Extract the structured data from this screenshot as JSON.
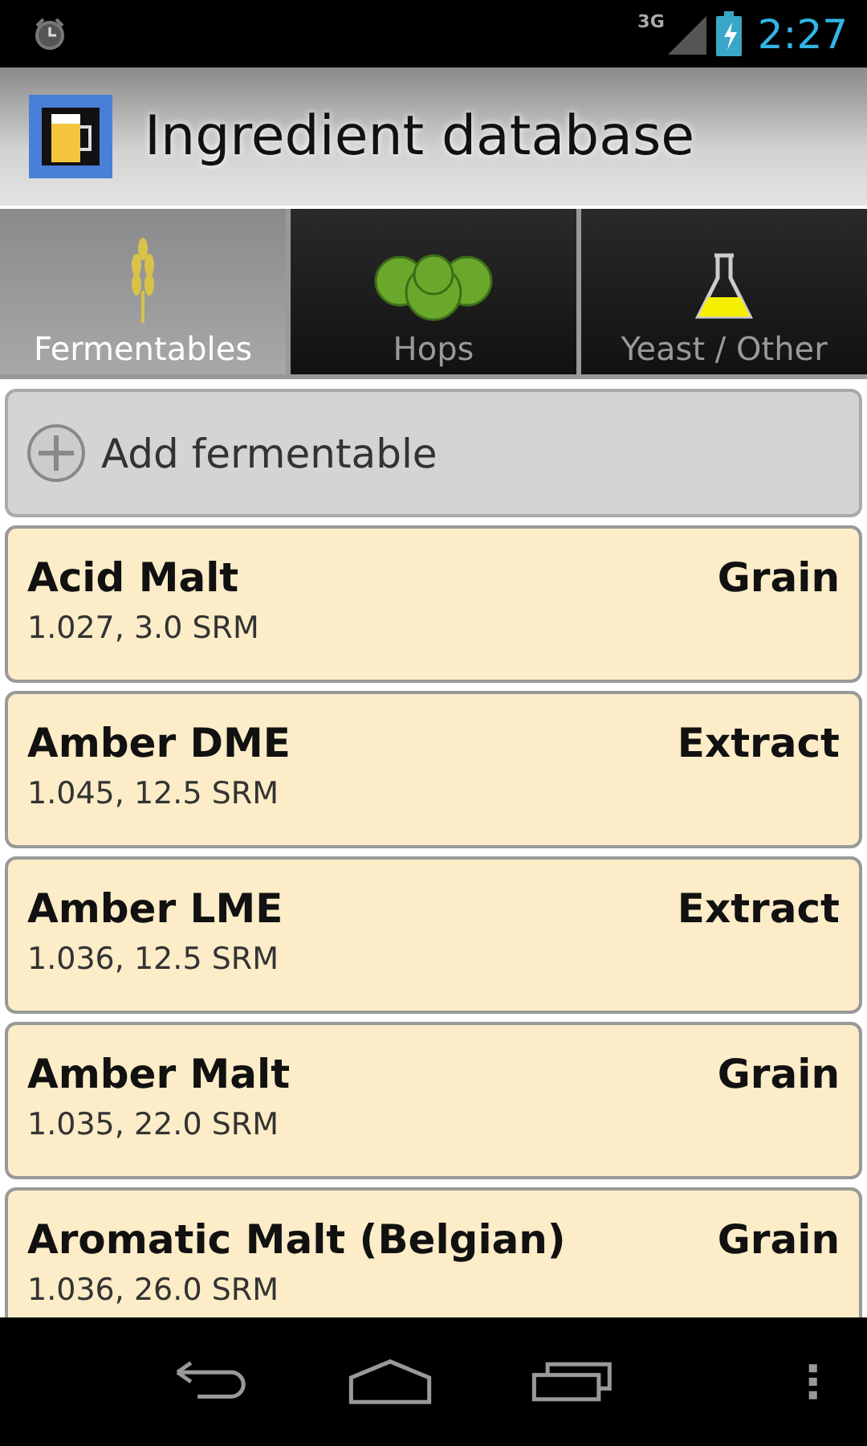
{
  "status_bar": {
    "network": "3G",
    "time": "2:27"
  },
  "action_bar": {
    "title": "Ingredient database"
  },
  "tabs": [
    {
      "label": "Fermentables",
      "kind": "wheat",
      "selected": true
    },
    {
      "label": "Hops",
      "kind": "hops",
      "selected": false
    },
    {
      "label": "Yeast / Other",
      "kind": "flask",
      "selected": false
    }
  ],
  "add_button": {
    "label": "Add fermentable"
  },
  "items": [
    {
      "name": "Acid Malt",
      "type": "Grain",
      "details": "1.027, 3.0 SRM"
    },
    {
      "name": "Amber DME",
      "type": "Extract",
      "details": "1.045, 12.5 SRM"
    },
    {
      "name": "Amber LME",
      "type": "Extract",
      "details": "1.036, 12.5 SRM"
    },
    {
      "name": "Amber Malt",
      "type": "Grain",
      "details": "1.035, 22.0 SRM"
    },
    {
      "name": "Aromatic Malt (Belgian)",
      "type": "Grain",
      "details": "1.036, 26.0 SRM"
    }
  ]
}
